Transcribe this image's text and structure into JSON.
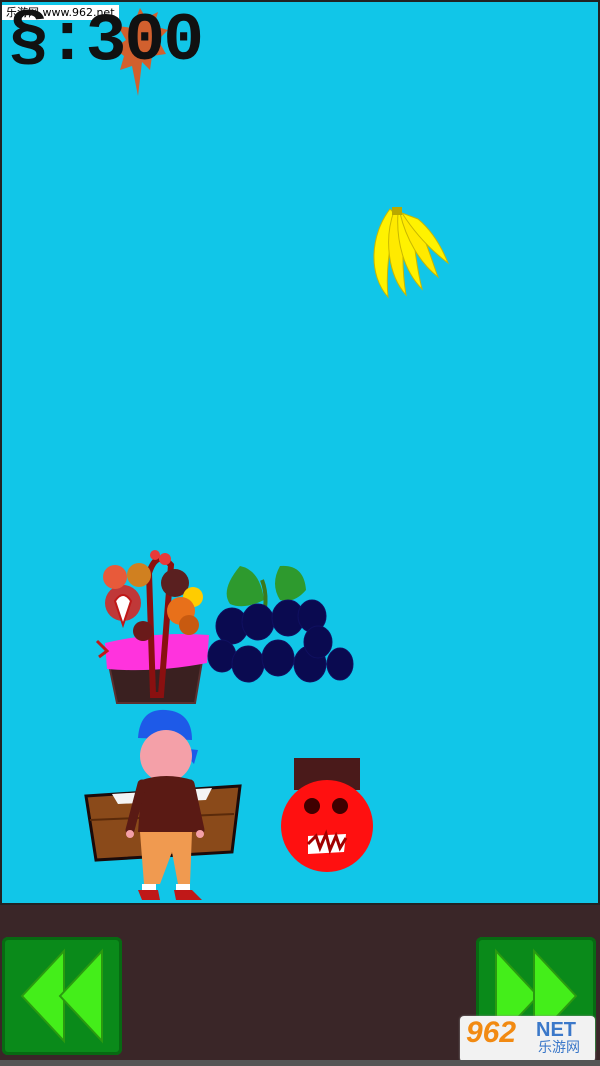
{
  "watermark": {
    "site_text": "乐游网 www.962.net",
    "logo_number": "962",
    "logo_suffix": "NET",
    "logo_cn": "乐游网"
  },
  "hud": {
    "currency_symbol": "§",
    "separator": ":",
    "score": "300"
  },
  "controls": {
    "left_icon": "rewind-icon",
    "right_icon": "fast-forward-icon"
  },
  "colors": {
    "sky": "#11c6e8",
    "ground": "#3a2628",
    "control_button": "#0a8a1a",
    "control_arrow": "#44ee1a"
  },
  "sprites": [
    "banana-icon",
    "fruit-basket-icon",
    "grapes-icon",
    "player-character",
    "wooden-box-icon",
    "red-tomato-enemy"
  ]
}
